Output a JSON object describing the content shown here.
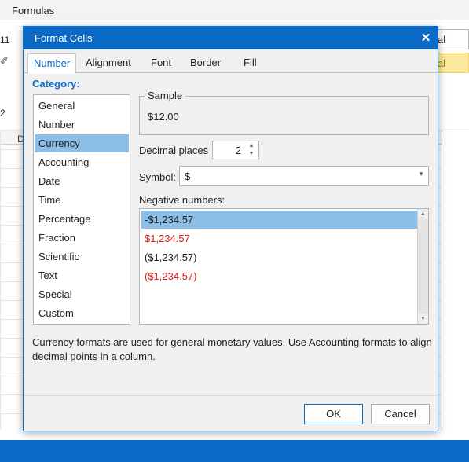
{
  "app": {
    "menu_formulas": "Formulas",
    "font_size": "11",
    "cell_ref": "2",
    "column_d": "D",
    "style_normal_1": "al",
    "style_normal_2": "al",
    "pencil_glyph": "✐"
  },
  "dialog": {
    "title": "Format Cells",
    "close_glyph": "✕",
    "tabs": [
      {
        "label": "Number",
        "active": true
      },
      {
        "label": "Alignment"
      },
      {
        "label": "Font"
      },
      {
        "label": "Border"
      },
      {
        "label": "Fill"
      }
    ],
    "category_heading": "Category:",
    "categories": [
      "General",
      "Number",
      "Currency",
      "Accounting",
      "Date",
      "Time",
      "Percentage",
      "Fraction",
      "Scientific",
      "Text",
      "Special",
      "Custom"
    ],
    "selected_category": "Currency",
    "sample": {
      "legend": "Sample",
      "value": "$12.00"
    },
    "decimal_places": {
      "label": "Decimal places",
      "value": "2"
    },
    "symbol": {
      "label": "Symbol:",
      "value": "$"
    },
    "negative_numbers": {
      "label": "Negative numbers:",
      "options": [
        {
          "text": "-$1,234.57",
          "color": "black",
          "selected": true
        },
        {
          "text": "$1,234.57",
          "color": "red"
        },
        {
          "text": "($1,234.57)",
          "color": "black"
        },
        {
          "text": "($1,234.57)",
          "color": "red"
        }
      ]
    },
    "description": "Currency formats are used for general monetary values. Use Accounting formats to align decimal points in a column.",
    "ok_label": "OK",
    "cancel_label": "Cancel"
  },
  "colors": {
    "accent": "#0a69c4",
    "selection": "#8dc0e8",
    "negative_red": "#e01b1b"
  }
}
